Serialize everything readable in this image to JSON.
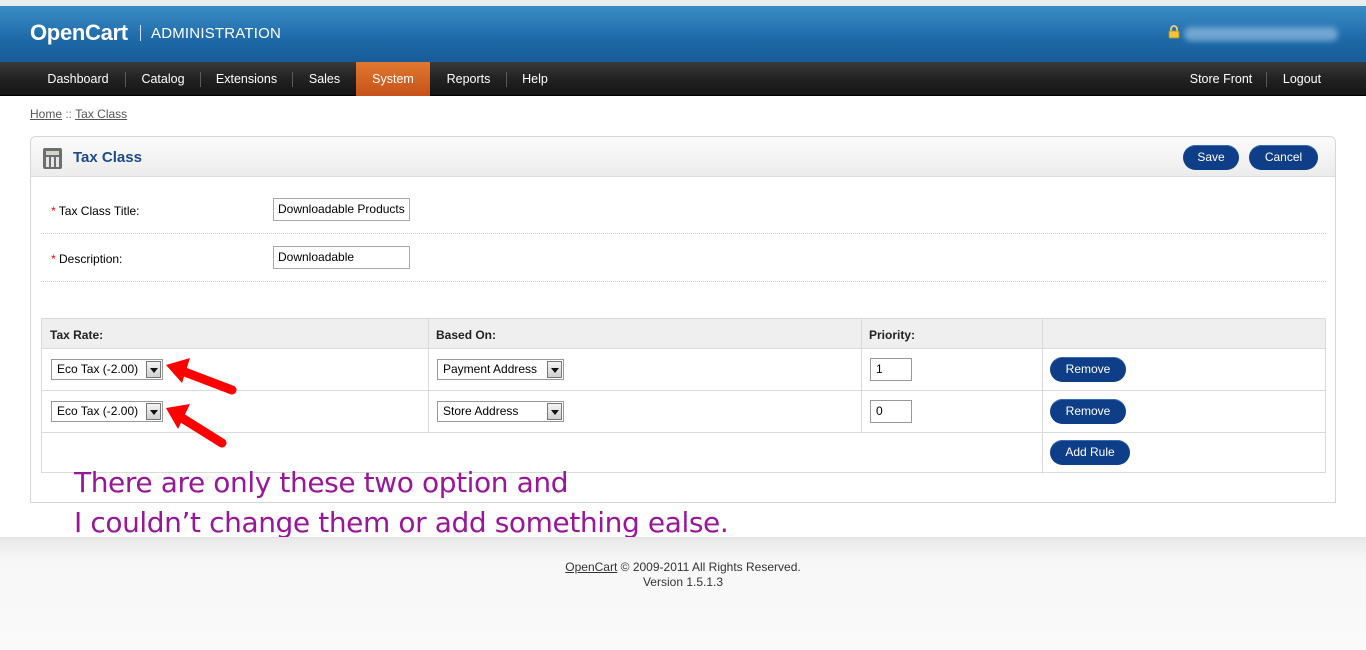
{
  "header": {
    "logo": "OpenCart",
    "subtitle": "ADMINISTRATION",
    "icon": "lock-icon"
  },
  "menu": {
    "left": [
      "Dashboard",
      "Catalog",
      "Extensions",
      "Sales",
      "System",
      "Reports",
      "Help"
    ],
    "right": [
      "Store Front",
      "Logout"
    ],
    "active": "System",
    "active_color": "#d5641f"
  },
  "breadcrumb": {
    "home": "Home",
    "separator": " :: ",
    "current": "Tax Class"
  },
  "panel": {
    "title": "Tax Class",
    "icon": "calculator-icon",
    "save_label": "Save",
    "cancel_label": "Cancel",
    "button_color": "#0e3e88"
  },
  "form": {
    "required_mark": "*",
    "title_label": "Tax Class Title:",
    "title_value": "Downloadable Products",
    "description_label": "Description:",
    "description_value": "Downloadable"
  },
  "rules": {
    "headers": {
      "tax_rate": "Tax Rate:",
      "based_on": "Based On:",
      "priority": "Priority:"
    },
    "rows": [
      {
        "tax_rate": "Eco Tax (-2.00)",
        "based_on": "Payment Address",
        "priority": "1",
        "remove_label": "Remove"
      },
      {
        "tax_rate": "Eco Tax (-2.00)",
        "based_on": "Store Address",
        "priority": "0",
        "remove_label": "Remove"
      }
    ],
    "add_rule_label": "Add Rule"
  },
  "annotation": {
    "line1": "There are only these two option and",
    "line2": "I couldn’t change them or add something ealse.",
    "text_color": "#99169a",
    "arrow_color": "#ff0000"
  },
  "footer": {
    "link": "OpenCart",
    "copyright": " © 2009-2011 All Rights Reserved.",
    "version": "Version 1.5.1.3"
  }
}
